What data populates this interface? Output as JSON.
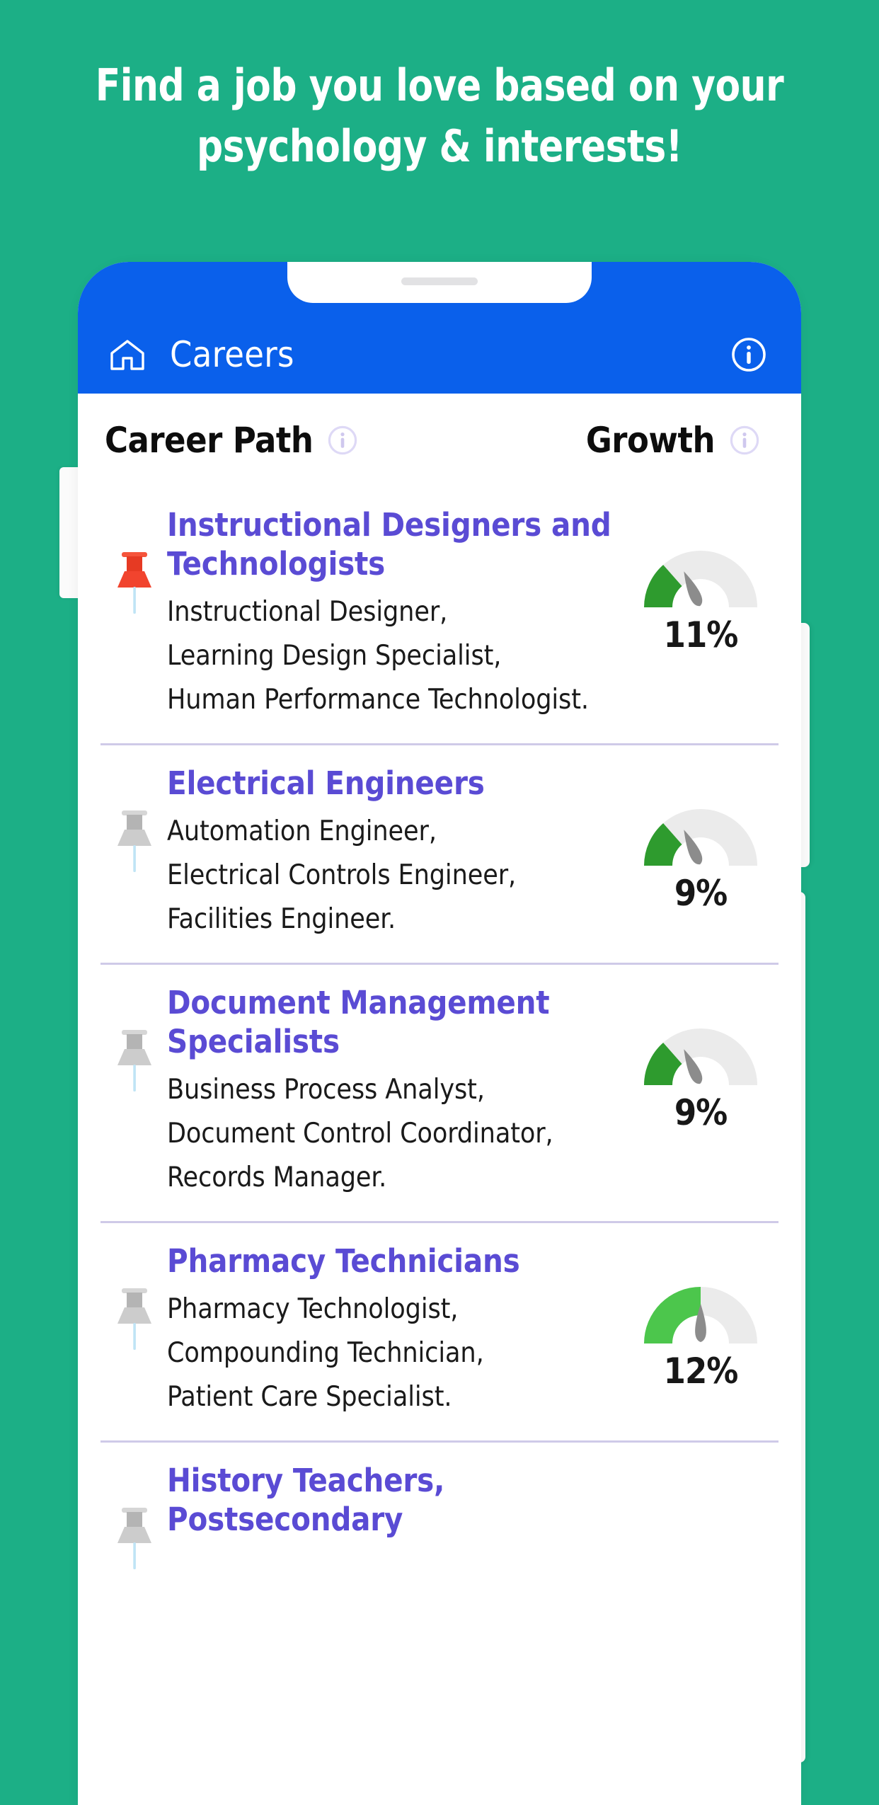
{
  "headline": {
    "line1": "Find a job you love based on your",
    "line2": "psychology & interests!"
  },
  "colors": {
    "background_green": "#1CAF86",
    "app_bar_blue": "#0A60EB",
    "job_title_purple": "#5A4BD4",
    "divider_lavender": "#cfcae8",
    "gauge_green_dark": "#2E9B2E",
    "gauge_green_bright": "#4CC64C",
    "gauge_track_gray": "#ebebeb",
    "needle_gray": "#8c8c8c",
    "pin_red": "#F1442E",
    "pin_gray": "#b9b9b9",
    "pin_needle_blue": "#bfe4f5"
  },
  "app_bar": {
    "home_icon": "home-icon",
    "title": "Careers",
    "info_icon": "info-circle-icon"
  },
  "column_headers": {
    "career_path": "Career Path",
    "career_path_info_icon": "info-circle-icon",
    "growth": "Growth",
    "growth_info_icon": "info-circle-icon"
  },
  "rows": [
    {
      "title": "Instructional Designers and Technologists",
      "pin": "pin-red",
      "jobs": [
        "Instructional Designer,",
        "Learning Design Specialist,",
        "Human Performance Technologist."
      ],
      "growth": "11%",
      "gauge_fill_fraction": 0.27,
      "gauge_needle_deg": 115,
      "gauge_green": "#2E9B2E"
    },
    {
      "title": "Electrical Engineers",
      "pin": "pin-gray",
      "jobs": [
        "Automation Engineer,",
        "Electrical Controls Engineer,",
        "Facilities Engineer."
      ],
      "growth": "9%",
      "gauge_fill_fraction": 0.27,
      "gauge_needle_deg": 115,
      "gauge_green": "#2E9B2E"
    },
    {
      "title": "Document Management Specialists",
      "pin": "pin-gray",
      "jobs": [
        "Business Process Analyst,",
        "Document Control Coordinator,",
        "Records Manager."
      ],
      "growth": "9%",
      "gauge_fill_fraction": 0.27,
      "gauge_needle_deg": 115,
      "gauge_green": "#2E9B2E"
    },
    {
      "title": "Pharmacy Technicians",
      "pin": "pin-gray",
      "jobs": [
        "Pharmacy Technologist,",
        "Compounding Technician,",
        "Patient Care Specialist."
      ],
      "growth": "12%",
      "gauge_fill_fraction": 0.5,
      "gauge_needle_deg": 90,
      "gauge_green": "#4CC64C"
    },
    {
      "title": "History Teachers, Postsecondary",
      "pin": "pin-gray",
      "jobs": [],
      "growth": "",
      "gauge_fill_fraction": 0,
      "gauge_needle_deg": 90,
      "gauge_green": "#2E9B2E"
    }
  ]
}
